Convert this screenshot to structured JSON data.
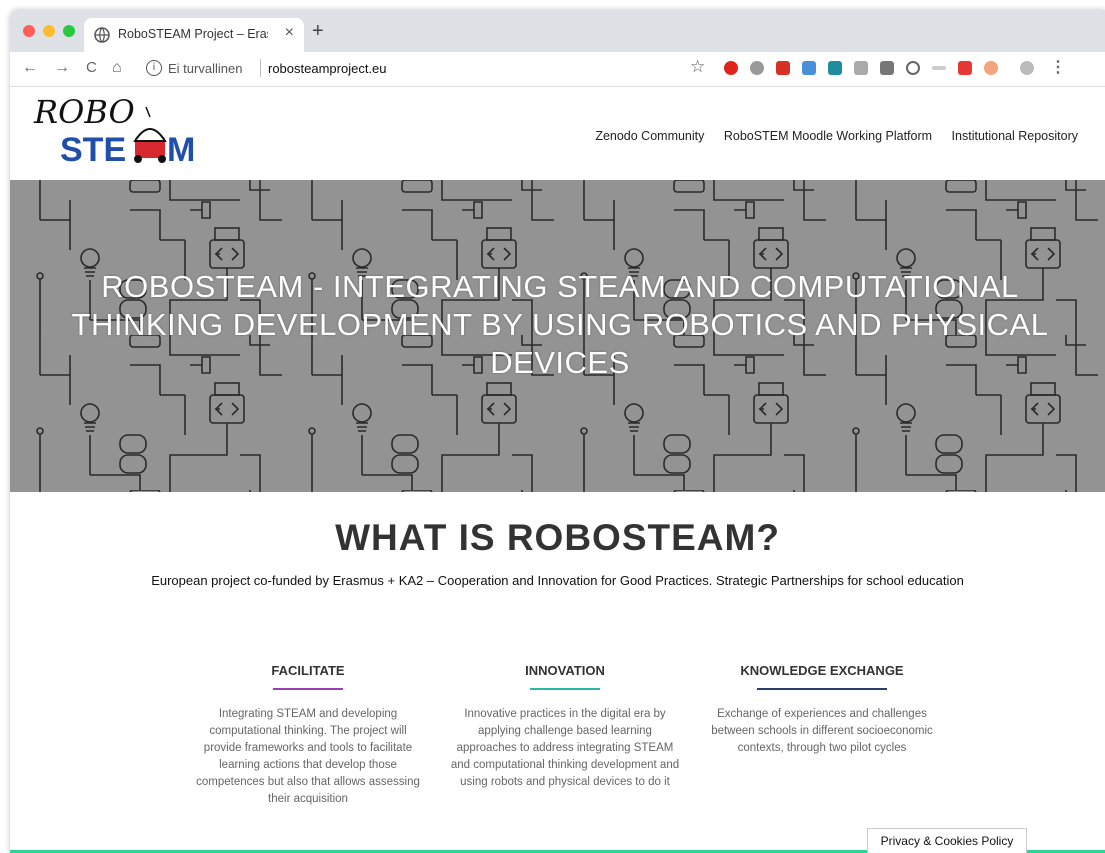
{
  "browser": {
    "tab_title": "RoboSTEAM Project – Erasmus+",
    "tab_close": "×",
    "new_tab": "+",
    "back": "←",
    "forward": "→",
    "reload": "C",
    "home": "⌂",
    "info_icon": "i",
    "security_label": "Ei turvallinen",
    "url": "robosteamproject.eu",
    "bookmark": "☆",
    "menu": "⋮",
    "traffic_colors": [
      "#ff5f57",
      "#febc2e",
      "#28c840"
    ]
  },
  "site": {
    "logo_top": "ROBO",
    "logo_bottom_left": "STE",
    "logo_bottom_right": "M",
    "nav": [
      "Zenodo Community",
      "RoboSTEM Moodle Working Platform",
      "Institutional Repository"
    ],
    "hero_title": "ROBOSTEAM - INTEGRATING STEAM AND COMPUTATIONAL THINKING DEVELOPMENT BY USING ROBOTICS AND PHYSICAL DEVICES",
    "section_title": "WHAT IS ROBOSTEAM?",
    "section_subtitle": "European project co-funded by Erasmus + KA2 – Cooperation and Innovation for Good Practices. Strategic Partnerships for school education",
    "columns": [
      {
        "title": "FACILITATE",
        "color": "#9b3fb2",
        "text": "Integrating STEAM and developing computational thinking. The project will provide frameworks and tools to facilitate learning actions that develop those competences but also that allows assessing their acquisition"
      },
      {
        "title": "INNOVATION",
        "color": "#2bb7a8",
        "text": "Innovative practices in the digital era by applying challenge based learning approaches to address integrating STEAM and computational thinking development and using robots and physical devices to do it"
      },
      {
        "title": "KNOWLEDGE EXCHANGE",
        "color": "#2c3e6b",
        "text": "Exchange of experiences and challenges between schools in different socioeconomic contexts, through two pilot cycles"
      }
    ],
    "privacy": "Privacy & Cookies Policy"
  }
}
